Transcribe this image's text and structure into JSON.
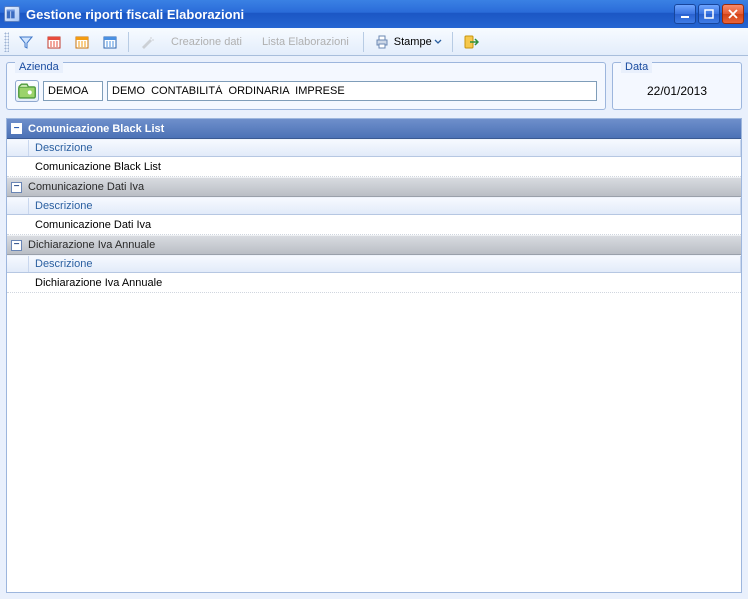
{
  "titlebar": {
    "title": "Gestione riporti fiscali Elaborazioni"
  },
  "toolbar": {
    "creazione_dati_label": "Creazione dati",
    "lista_elab_label": "Lista Elaborazioni",
    "stampe_label": "Stampe"
  },
  "header": {
    "azienda_label": "Azienda",
    "azienda_code": "DEMOA",
    "azienda_desc": "DEMO  CONTABILITÀ  ORDINARIA  IMPRESE",
    "data_label": "Data",
    "data_value": "22/01/2013"
  },
  "grid": {
    "col_descrizione": "Descrizione",
    "groups": [
      {
        "title": "Comunicazione Black List",
        "value": "Comunicazione Black List",
        "primary": true
      },
      {
        "title": "Comunicazione Dati Iva",
        "value": "Comunicazione Dati Iva",
        "primary": false
      },
      {
        "title": "Dichiarazione Iva Annuale",
        "value": "Dichiarazione Iva Annuale",
        "primary": false
      }
    ]
  }
}
